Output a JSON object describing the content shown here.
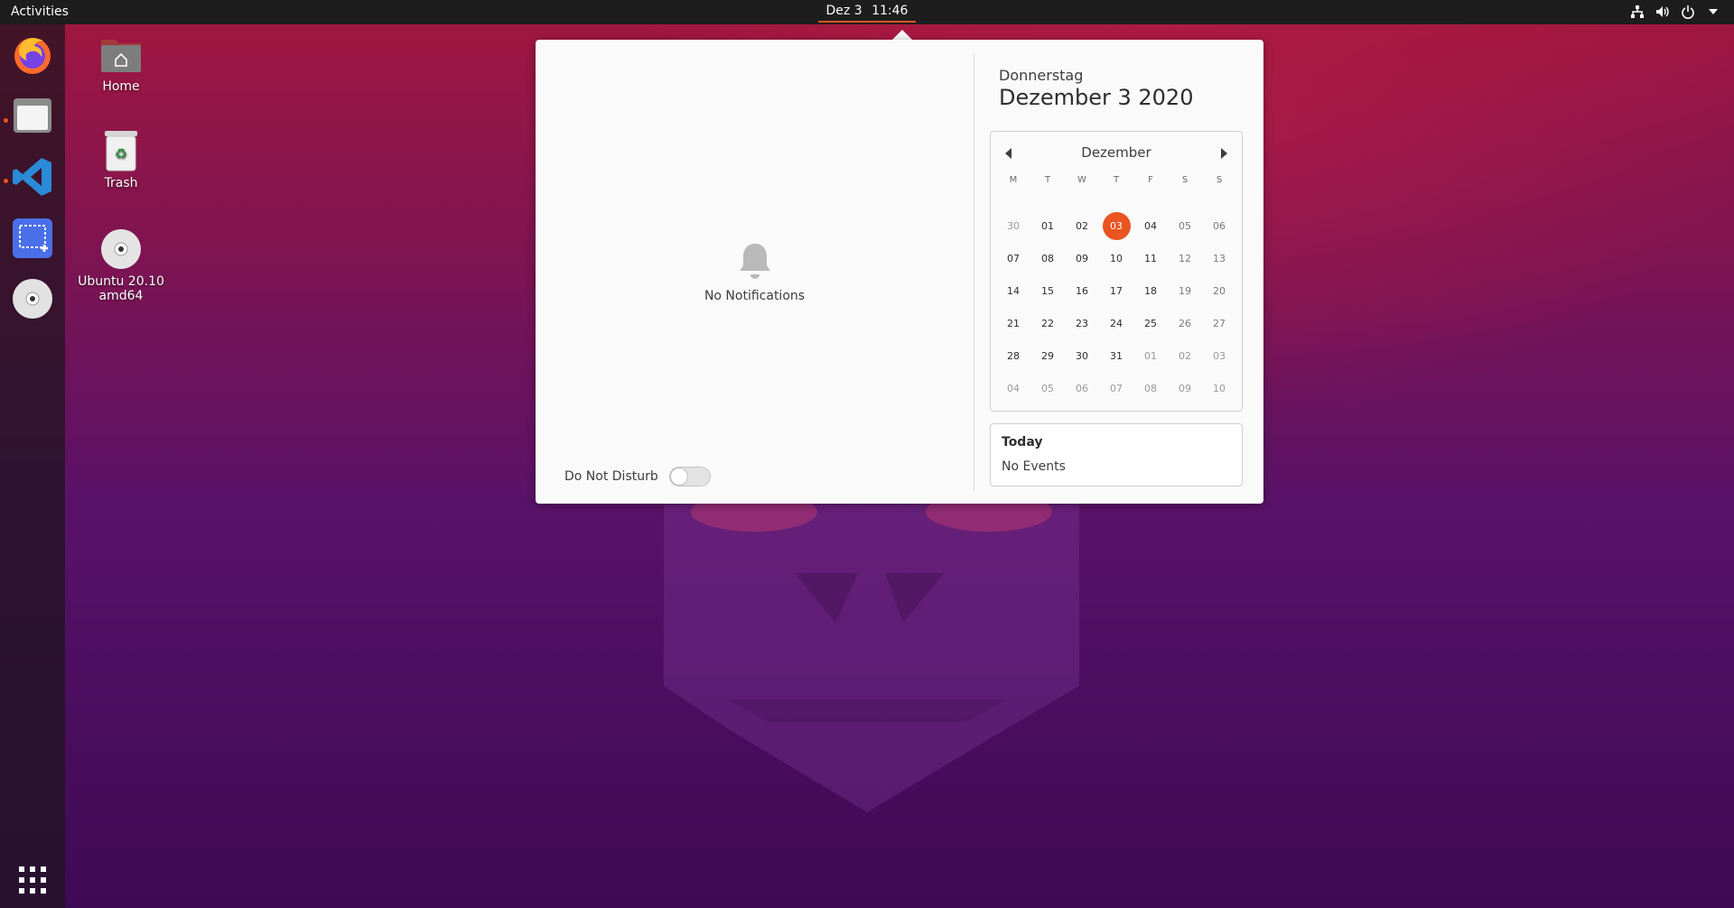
{
  "topbar": {
    "activities": "Activities",
    "date": "Dez 3",
    "time": "11:46",
    "tray_icons": [
      "network-icon",
      "volume-icon",
      "power-icon",
      "chevron-down-icon"
    ]
  },
  "dock": {
    "apps": [
      "firefox",
      "files",
      "visual-studio-code",
      "screenshot",
      "optical-disc"
    ],
    "show_apps_icon": "grid-icon"
  },
  "desktop": {
    "home_label": "Home",
    "trash_label": "Trash",
    "disc_label_line1": "Ubuntu 20.10",
    "disc_label_line2": "amd64"
  },
  "notifications": {
    "empty_text": "No Notifications",
    "dnd_label": "Do Not Disturb",
    "dnd_enabled": false
  },
  "calendar": {
    "weekday": "Donnerstag",
    "full_date": "Dezember 3 2020",
    "month": "Dezember",
    "dow": [
      "M",
      "T",
      "W",
      "T",
      "F",
      "S",
      "S"
    ],
    "weeks": [
      [
        "30",
        "01",
        "02",
        "03",
        "04",
        "05",
        "06"
      ],
      [
        "07",
        "08",
        "09",
        "10",
        "11",
        "12",
        "13"
      ],
      [
        "14",
        "15",
        "16",
        "17",
        "18",
        "19",
        "20"
      ],
      [
        "21",
        "22",
        "23",
        "24",
        "25",
        "26",
        "27"
      ],
      [
        "28",
        "29",
        "30",
        "31",
        "01",
        "02",
        "03"
      ],
      [
        "04",
        "05",
        "06",
        "07",
        "08",
        "09",
        "10"
      ]
    ],
    "today_value": "03",
    "accent": "#e95420"
  },
  "events": {
    "title": "Today",
    "body": "No Events"
  }
}
